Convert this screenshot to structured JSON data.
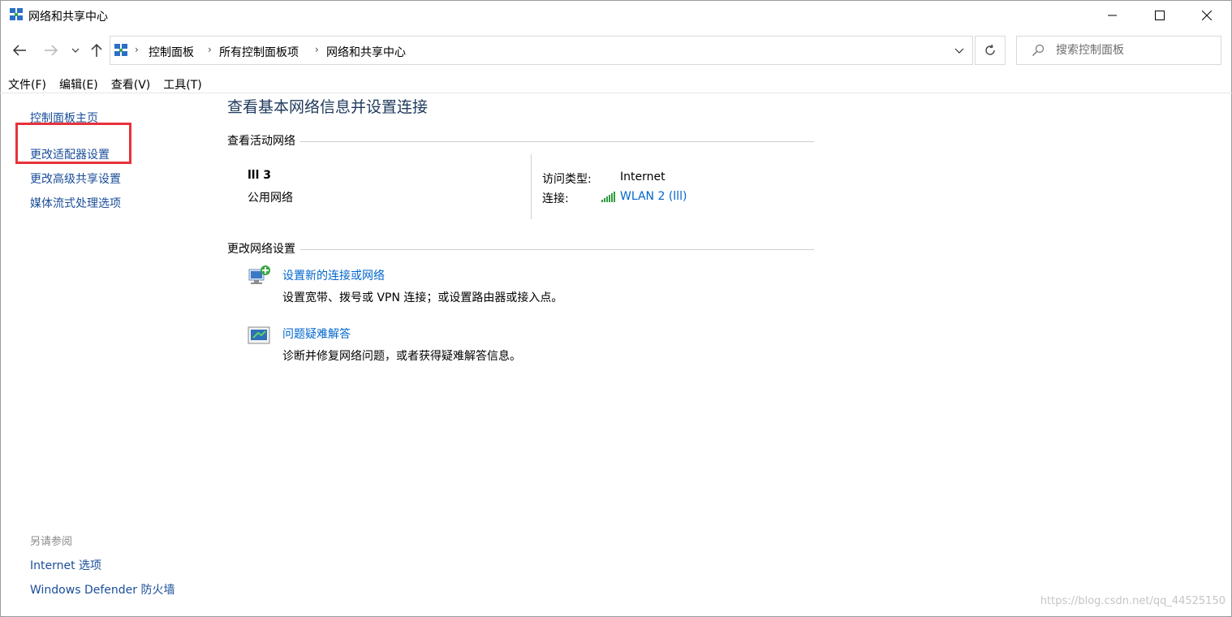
{
  "window": {
    "title": "网络和共享中心",
    "icon": "network-center-icon",
    "controls": [
      "minimize-icon",
      "maximize-icon",
      "close-icon"
    ]
  },
  "navigation": {
    "back": "back-arrow-icon",
    "forward": "forward-arrow-icon",
    "recent": "chevron-down-icon",
    "up": "up-arrow-icon"
  },
  "address": {
    "crumbs": [
      "控制面板",
      "所有控制面板项",
      "网络和共享中心"
    ]
  },
  "search": {
    "placeholder": "搜索控制面板"
  },
  "menu": [
    "文件(F)",
    "编辑(E)",
    "查看(V)",
    "工具(T)"
  ],
  "sidebar": {
    "links": [
      "控制面板主页",
      "更改适配器设置",
      "更改高级共享设置",
      "媒体流式处理选项"
    ],
    "see_also_label": "另请参阅",
    "see_also": [
      "Internet 选项",
      "Windows Defender 防火墙"
    ],
    "highlight_color": "#e8323a"
  },
  "main": {
    "title": "查看基本网络信息并设置连接",
    "active_networks_heading": "查看活动网络",
    "network": {
      "name": "lll 3",
      "type": "公用网络",
      "access_label": "访问类型:",
      "access_value": "Internet",
      "connection_label": "连接:",
      "connection_value": "WLAN 2 (lll)"
    },
    "change_settings_heading": "更改网络设置",
    "tasks": [
      {
        "title": "设置新的连接或网络",
        "description": "设置宽带、拨号或 VPN 连接；或设置路由器或接入点。",
        "icon": "new-connection-icon"
      },
      {
        "title": "问题疑难解答",
        "description": "诊断并修复网络问题，或者获得疑难解答信息。",
        "icon": "troubleshoot-icon"
      }
    ]
  },
  "watermark": "https://blog.csdn.net/qq_44525150",
  "colors": {
    "link": "#0066cc",
    "nav_link": "#1a4d99",
    "title": "#1e395b"
  }
}
